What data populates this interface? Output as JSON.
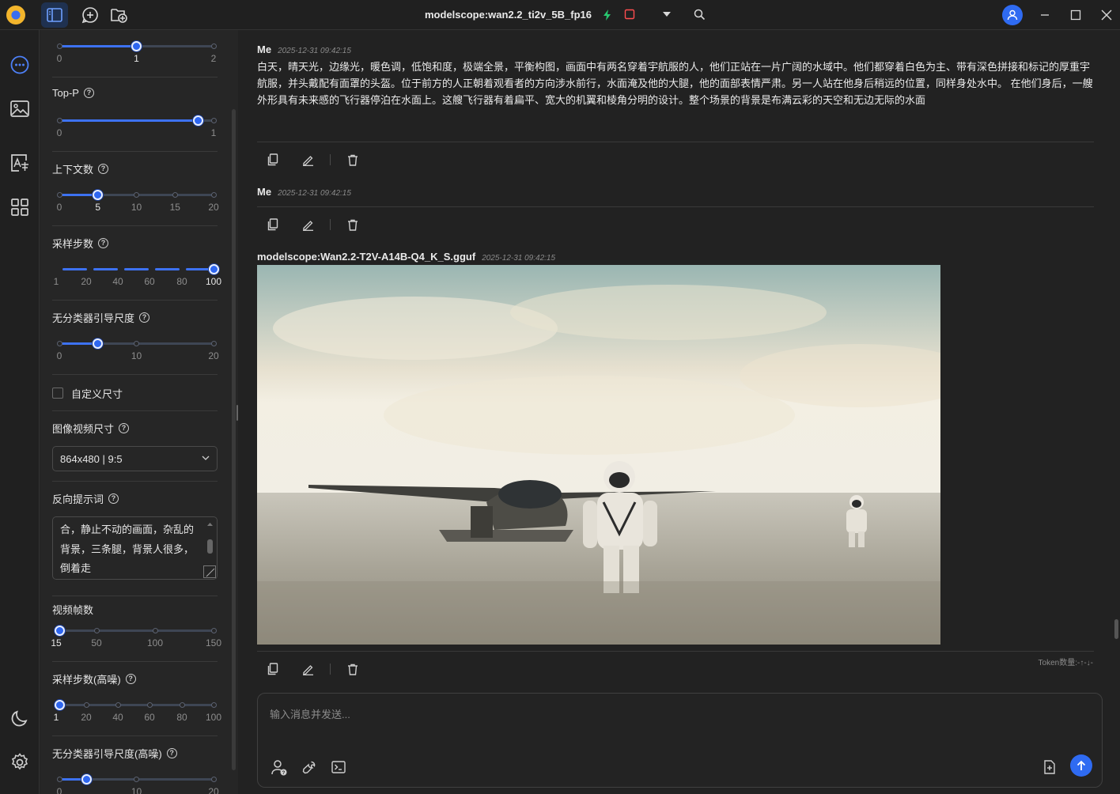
{
  "titlebar": {
    "title": "modelscope:wan2.2_ti2v_5B_fp16"
  },
  "colors": {
    "accent": "#2f6bf2",
    "background": "#222222",
    "panel": "#262626"
  },
  "settings": {
    "temp_ticks": [
      "0",
      "1",
      "2"
    ],
    "temp_value": 1,
    "topp_label": "Top-P",
    "topp_ticks": [
      "0",
      "1"
    ],
    "topp_value": 0.9,
    "context_label": "上下文数",
    "context_ticks": [
      "0",
      "5",
      "10",
      "15",
      "20"
    ],
    "context_value": 5,
    "steps_label": "采样步数",
    "steps_ticks": [
      "1",
      "20",
      "40",
      "60",
      "80",
      "100"
    ],
    "steps_value": 100,
    "cfg_label": "无分类器引导尺度",
    "cfg_ticks": [
      "0",
      "10",
      "20"
    ],
    "cfg_value": 5,
    "custom_size_label": "自定义尺寸",
    "size_label": "图像视频尺寸",
    "size_value": "864x480 | 9:5",
    "neg_label": "反向提示词",
    "neg_value": "合，静止不动的画面，杂乱的背景，三条腿，背景人很多，倒着走",
    "frames_label": "视频帧数",
    "frames_ticks": [
      "15",
      "50",
      "100",
      "150"
    ],
    "frames_value": 15,
    "steps_hi_label": "采样步数(高噪)",
    "steps_hi_ticks": [
      "1",
      "20",
      "40",
      "60",
      "80",
      "100"
    ],
    "steps_hi_value": 1,
    "cfg_hi_label": "无分类器引导尺度(高噪)",
    "cfg_hi_ticks": [
      "0",
      "10",
      "20"
    ],
    "cfg_hi_value": 3.5
  },
  "messages": [
    {
      "author": "Me",
      "time": "2025-12-31 09:42:15",
      "text": "白天，晴天光，边缘光，暖色调，低饱和度，极端全景，平衡构图，画面中有两名穿着宇航服的人，他们正站在一片广阔的水域中。他们都穿着白色为主、带有深色拼接和标记的厚重宇航服，并头戴配有面罩的头盔。位于前方的人正朝着观看者的方向涉水前行，水面淹及他的大腿，他的面部表情严肃。另一人站在他身后稍远的位置，同样身处水中。 在他们身后，一艘外形具有未来感的飞行器停泊在水面上。这艘飞行器有着扁平、宽大的机翼和棱角分明的设计。整个场景的背景是布满云彩的天空和无边无际的水面"
    },
    {
      "author": "Me",
      "time": "2025-12-31 09:42:15",
      "text": ""
    },
    {
      "author": "modelscope:Wan2.2-T2V-A14B-Q4_K_S.gguf",
      "time": "2025-12-31 09:42:15",
      "text": ""
    }
  ],
  "token_info": "Token数量:-↑-↓-",
  "composer": {
    "placeholder": "输入消息并发送..."
  }
}
